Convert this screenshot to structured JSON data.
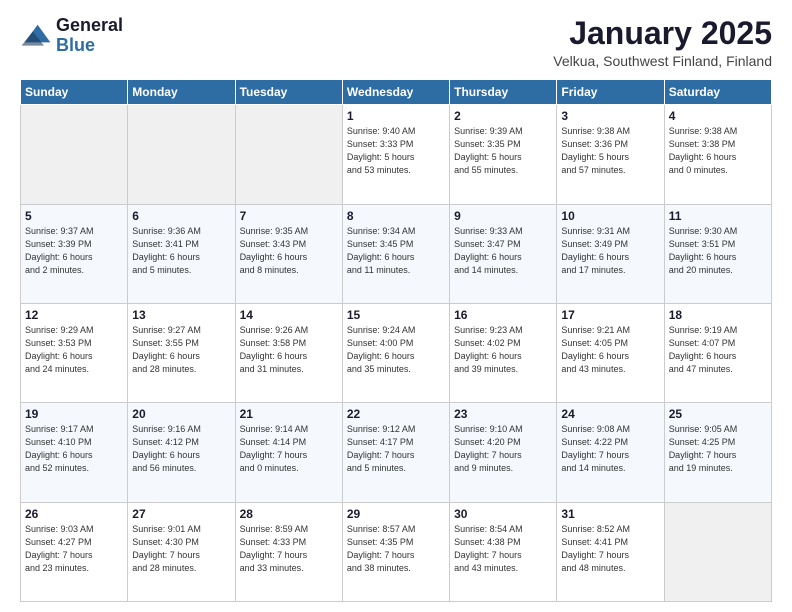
{
  "logo": {
    "general": "General",
    "blue": "Blue"
  },
  "header": {
    "month": "January 2025",
    "location": "Velkua, Southwest Finland, Finland"
  },
  "days_of_week": [
    "Sunday",
    "Monday",
    "Tuesday",
    "Wednesday",
    "Thursday",
    "Friday",
    "Saturday"
  ],
  "weeks": [
    [
      {
        "day": "",
        "info": ""
      },
      {
        "day": "",
        "info": ""
      },
      {
        "day": "",
        "info": ""
      },
      {
        "day": "1",
        "info": "Sunrise: 9:40 AM\nSunset: 3:33 PM\nDaylight: 5 hours\nand 53 minutes."
      },
      {
        "day": "2",
        "info": "Sunrise: 9:39 AM\nSunset: 3:35 PM\nDaylight: 5 hours\nand 55 minutes."
      },
      {
        "day": "3",
        "info": "Sunrise: 9:38 AM\nSunset: 3:36 PM\nDaylight: 5 hours\nand 57 minutes."
      },
      {
        "day": "4",
        "info": "Sunrise: 9:38 AM\nSunset: 3:38 PM\nDaylight: 6 hours\nand 0 minutes."
      }
    ],
    [
      {
        "day": "5",
        "info": "Sunrise: 9:37 AM\nSunset: 3:39 PM\nDaylight: 6 hours\nand 2 minutes."
      },
      {
        "day": "6",
        "info": "Sunrise: 9:36 AM\nSunset: 3:41 PM\nDaylight: 6 hours\nand 5 minutes."
      },
      {
        "day": "7",
        "info": "Sunrise: 9:35 AM\nSunset: 3:43 PM\nDaylight: 6 hours\nand 8 minutes."
      },
      {
        "day": "8",
        "info": "Sunrise: 9:34 AM\nSunset: 3:45 PM\nDaylight: 6 hours\nand 11 minutes."
      },
      {
        "day": "9",
        "info": "Sunrise: 9:33 AM\nSunset: 3:47 PM\nDaylight: 6 hours\nand 14 minutes."
      },
      {
        "day": "10",
        "info": "Sunrise: 9:31 AM\nSunset: 3:49 PM\nDaylight: 6 hours\nand 17 minutes."
      },
      {
        "day": "11",
        "info": "Sunrise: 9:30 AM\nSunset: 3:51 PM\nDaylight: 6 hours\nand 20 minutes."
      }
    ],
    [
      {
        "day": "12",
        "info": "Sunrise: 9:29 AM\nSunset: 3:53 PM\nDaylight: 6 hours\nand 24 minutes."
      },
      {
        "day": "13",
        "info": "Sunrise: 9:27 AM\nSunset: 3:55 PM\nDaylight: 6 hours\nand 28 minutes."
      },
      {
        "day": "14",
        "info": "Sunrise: 9:26 AM\nSunset: 3:58 PM\nDaylight: 6 hours\nand 31 minutes."
      },
      {
        "day": "15",
        "info": "Sunrise: 9:24 AM\nSunset: 4:00 PM\nDaylight: 6 hours\nand 35 minutes."
      },
      {
        "day": "16",
        "info": "Sunrise: 9:23 AM\nSunset: 4:02 PM\nDaylight: 6 hours\nand 39 minutes."
      },
      {
        "day": "17",
        "info": "Sunrise: 9:21 AM\nSunset: 4:05 PM\nDaylight: 6 hours\nand 43 minutes."
      },
      {
        "day": "18",
        "info": "Sunrise: 9:19 AM\nSunset: 4:07 PM\nDaylight: 6 hours\nand 47 minutes."
      }
    ],
    [
      {
        "day": "19",
        "info": "Sunrise: 9:17 AM\nSunset: 4:10 PM\nDaylight: 6 hours\nand 52 minutes."
      },
      {
        "day": "20",
        "info": "Sunrise: 9:16 AM\nSunset: 4:12 PM\nDaylight: 6 hours\nand 56 minutes."
      },
      {
        "day": "21",
        "info": "Sunrise: 9:14 AM\nSunset: 4:14 PM\nDaylight: 7 hours\nand 0 minutes."
      },
      {
        "day": "22",
        "info": "Sunrise: 9:12 AM\nSunset: 4:17 PM\nDaylight: 7 hours\nand 5 minutes."
      },
      {
        "day": "23",
        "info": "Sunrise: 9:10 AM\nSunset: 4:20 PM\nDaylight: 7 hours\nand 9 minutes."
      },
      {
        "day": "24",
        "info": "Sunrise: 9:08 AM\nSunset: 4:22 PM\nDaylight: 7 hours\nand 14 minutes."
      },
      {
        "day": "25",
        "info": "Sunrise: 9:05 AM\nSunset: 4:25 PM\nDaylight: 7 hours\nand 19 minutes."
      }
    ],
    [
      {
        "day": "26",
        "info": "Sunrise: 9:03 AM\nSunset: 4:27 PM\nDaylight: 7 hours\nand 23 minutes."
      },
      {
        "day": "27",
        "info": "Sunrise: 9:01 AM\nSunset: 4:30 PM\nDaylight: 7 hours\nand 28 minutes."
      },
      {
        "day": "28",
        "info": "Sunrise: 8:59 AM\nSunset: 4:33 PM\nDaylight: 7 hours\nand 33 minutes."
      },
      {
        "day": "29",
        "info": "Sunrise: 8:57 AM\nSunset: 4:35 PM\nDaylight: 7 hours\nand 38 minutes."
      },
      {
        "day": "30",
        "info": "Sunrise: 8:54 AM\nSunset: 4:38 PM\nDaylight: 7 hours\nand 43 minutes."
      },
      {
        "day": "31",
        "info": "Sunrise: 8:52 AM\nSunset: 4:41 PM\nDaylight: 7 hours\nand 48 minutes."
      },
      {
        "day": "",
        "info": ""
      }
    ]
  ]
}
